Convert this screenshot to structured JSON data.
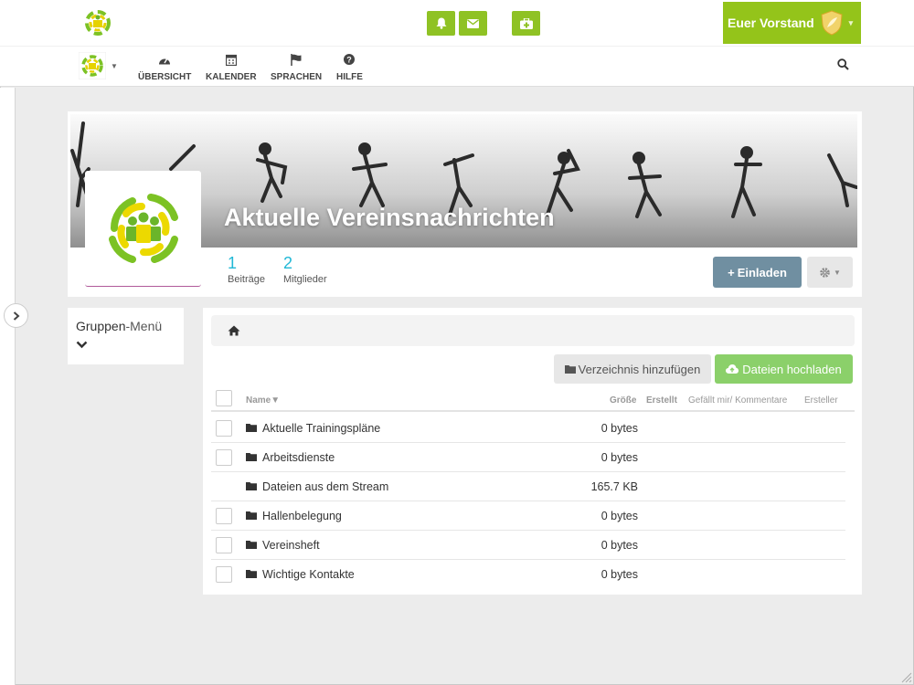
{
  "header": {
    "user_name": "Euer Vorstand",
    "buttons": [
      "bell-icon",
      "envelope-icon",
      "medkit-icon"
    ]
  },
  "nav": {
    "items": [
      {
        "label": "ÜBERSICHT",
        "icon": "dashboard-icon"
      },
      {
        "label": "KALENDER",
        "icon": "calendar-icon"
      },
      {
        "label": "SPRACHEN",
        "icon": "flag-icon"
      },
      {
        "label": "HILFE",
        "icon": "question-icon"
      }
    ]
  },
  "group": {
    "title": "Aktuelle Vereinsnachrichten",
    "stats": [
      {
        "value": "1",
        "label": "Beiträge"
      },
      {
        "value": "2",
        "label": "Mitglieder"
      }
    ],
    "invite_label": "Einladen"
  },
  "group_menu": {
    "title_bold": "Gruppen",
    "title_rest": "-Menü"
  },
  "files": {
    "add_dir_label": "Verzeichnis hinzufügen",
    "upload_label": "Dateien hochladen",
    "columns": {
      "name": "Name▼",
      "size": "Größe",
      "created": "Erstellt",
      "likes": "Gefällt mir/ Kommentare",
      "creator": "Ersteller"
    },
    "rows": [
      {
        "name": "Aktuelle Trainingspläne",
        "size": "0 bytes",
        "checkbox": true
      },
      {
        "name": "Arbeitsdienste",
        "size": "0 bytes",
        "checkbox": true
      },
      {
        "name": "Dateien aus dem Stream",
        "size": "165.7 KB",
        "checkbox": false
      },
      {
        "name": "Hallenbelegung",
        "size": "0 bytes",
        "checkbox": true
      },
      {
        "name": "Vereinsheft",
        "size": "0 bytes",
        "checkbox": true
      },
      {
        "name": "Wichtige Kontakte",
        "size": "0 bytes",
        "checkbox": true
      }
    ]
  },
  "colors": {
    "accent_green": "#94c41a",
    "stat_blue": "#21b8d6",
    "invite_blue": "#708fa1",
    "upload_green": "#8bd06a"
  }
}
